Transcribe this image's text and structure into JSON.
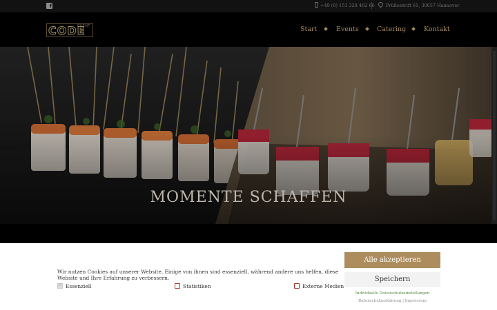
{
  "topbar": {
    "facebook_icon": "facebook-square-icon",
    "phone_icon": "phone-icon",
    "phone": "+49 (0) 151 228 462 66",
    "address_icon": "map-pin-icon",
    "address": "Prüßentrift 61, 30657 Hannover"
  },
  "header": {
    "logo_small": "EVENT",
    "logo_text": "CODE",
    "nav": [
      "Start",
      "Events",
      "Catering",
      "Kontakt"
    ]
  },
  "hero": {
    "title": "MOMENTE SCHAFFEN"
  },
  "cookie": {
    "text": "Wir nutzen Cookies auf unserer Website. Einige von ihnen sind essenziell, während andere uns helfen, diese Website und Ihre Erfahrung zu verbessern.",
    "options": [
      {
        "label": "Essenziell",
        "checked": true,
        "disabled": true
      },
      {
        "label": "Statistiken",
        "checked": false
      },
      {
        "label": "Externe Medien",
        "checked": false
      }
    ],
    "accept_all": "Alle akzeptieren",
    "save": "Speichern",
    "individual": "Individuelle Datenschutzeinstellungen",
    "privacy": "Datenschutzerklärung",
    "imprint": "Impressum"
  },
  "colors": {
    "accent": "#ad8d5d",
    "nav": "#a68a5b",
    "link_green": "#4f8a3c",
    "checkbox_red": "#a63a2a"
  }
}
